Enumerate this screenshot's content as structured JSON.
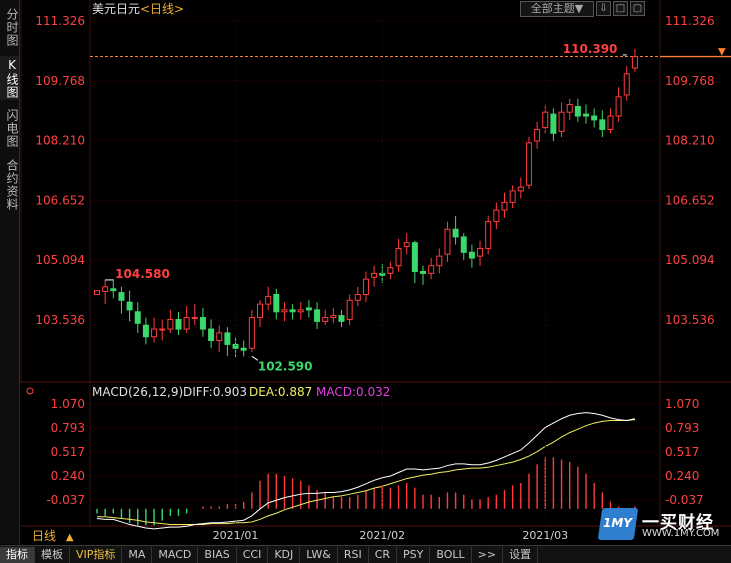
{
  "left_tabs": [
    "分时图",
    "K线图",
    "闪电图",
    "合约资料"
  ],
  "left_tabs_active": 1,
  "header": {
    "symbol": "美元日元",
    "period_tag": "<日线>",
    "theme_button": "全部主题▼",
    "win_buttons": [
      "⇩",
      "□",
      "▢"
    ]
  },
  "bottom": {
    "period_label": "日线",
    "period_arrow": "▲",
    "tabs": [
      "指标",
      "模板",
      "VIP指标",
      "MA",
      "MACD",
      "BIAS",
      "CCI",
      "KDJ",
      "LW&",
      "RSI",
      "CR",
      "PSY",
      "BOLL",
      ">>",
      "设置"
    ],
    "active_tab": 0
  },
  "logo": {
    "badge": "1MY",
    "main": "一买财经",
    "url": "WWW.1MY.COM"
  },
  "colors": {
    "up": "#ff3b3b",
    "down": "#3bd96b",
    "diff": "#ffffff",
    "dea": "#f0f060",
    "macd_label": "#e040e0",
    "axis": "#ff4040",
    "grid": "#3a1010",
    "last_line": "#ff8030"
  },
  "chart_data": [
    {
      "type": "candlestick",
      "title": "美元日元<日线>",
      "ylim": [
        102.3,
        111.9
      ],
      "yticks": [
        111.326,
        109.768,
        108.21,
        106.652,
        105.094,
        103.536
      ],
      "ytick_labels": [
        "111.326",
        "109.768",
        "108.210",
        "106.652",
        "105.094",
        "103.536"
      ],
      "xtick_labels": [
        {
          "label": "2021/01",
          "index": 17
        },
        {
          "label": "2021/02",
          "index": 35
        },
        {
          "label": "2021/03",
          "index": 55
        }
      ],
      "annotations": {
        "high_label": "110.390",
        "high_index": 65,
        "high_value": 110.39,
        "prev_high_label": "104.580",
        "prev_high_index": 1,
        "prev_high_value": 104.58,
        "low_label": "102.590",
        "low_index": 19,
        "low_value": 102.59,
        "last_price": 110.4
      },
      "candles": [
        [
          104.2,
          104.3,
          104.2,
          104.3
        ],
        [
          104.28,
          104.4,
          104.58,
          103.95
        ],
        [
          104.35,
          104.3,
          104.6,
          104.1
        ],
        [
          104.25,
          104.05,
          104.4,
          103.7
        ],
        [
          104.0,
          103.8,
          104.3,
          103.5
        ],
        [
          103.75,
          103.45,
          104.0,
          103.2
        ],
        [
          103.4,
          103.1,
          103.6,
          102.9
        ],
        [
          103.1,
          103.3,
          103.6,
          102.95
        ],
        [
          103.3,
          103.3,
          103.55,
          103.0
        ],
        [
          103.3,
          103.55,
          103.8,
          103.2
        ],
        [
          103.55,
          103.3,
          103.75,
          103.15
        ],
        [
          103.3,
          103.6,
          103.9,
          103.2
        ],
        [
          103.6,
          103.6,
          103.95,
          103.4
        ],
        [
          103.6,
          103.3,
          103.85,
          103.1
        ],
        [
          103.3,
          103.0,
          103.55,
          102.8
        ],
        [
          103.0,
          103.2,
          103.4,
          102.7
        ],
        [
          103.2,
          102.9,
          103.35,
          102.6
        ],
        [
          102.9,
          102.8,
          103.1,
          102.55
        ],
        [
          102.8,
          102.75,
          103.0,
          102.59
        ],
        [
          102.8,
          103.6,
          103.8,
          102.7
        ],
        [
          103.6,
          103.95,
          104.05,
          103.35
        ],
        [
          103.95,
          104.15,
          104.4,
          103.8
        ],
        [
          104.2,
          103.75,
          104.35,
          103.55
        ],
        [
          103.75,
          103.8,
          104.0,
          103.5
        ],
        [
          103.8,
          103.75,
          103.95,
          103.55
        ],
        [
          103.75,
          103.8,
          104.0,
          103.55
        ],
        [
          103.85,
          103.8,
          104.05,
          103.6
        ],
        [
          103.8,
          103.5,
          104.0,
          103.3
        ],
        [
          103.5,
          103.6,
          103.8,
          103.4
        ],
        [
          103.6,
          103.65,
          103.85,
          103.45
        ],
        [
          103.65,
          103.5,
          103.8,
          103.35
        ],
        [
          103.55,
          104.05,
          104.2,
          103.4
        ],
        [
          104.05,
          104.2,
          104.4,
          103.9
        ],
        [
          104.2,
          104.6,
          104.8,
          104.0
        ],
        [
          104.65,
          104.75,
          104.95,
          104.4
        ],
        [
          104.75,
          104.7,
          105.0,
          104.5
        ],
        [
          104.75,
          104.9,
          105.05,
          104.6
        ],
        [
          104.95,
          105.4,
          105.65,
          104.8
        ],
        [
          105.45,
          105.55,
          105.8,
          105.25
        ],
        [
          105.55,
          104.8,
          105.6,
          104.5
        ],
        [
          104.8,
          104.75,
          104.95,
          104.45
        ],
        [
          104.75,
          104.95,
          105.15,
          104.6
        ],
        [
          104.95,
          105.2,
          105.4,
          104.75
        ],
        [
          105.25,
          105.9,
          106.1,
          105.05
        ],
        [
          105.9,
          105.7,
          106.25,
          105.5
        ],
        [
          105.7,
          105.3,
          105.8,
          105.1
        ],
        [
          105.3,
          105.15,
          105.5,
          104.9
        ],
        [
          105.2,
          105.4,
          105.6,
          104.95
        ],
        [
          105.4,
          106.1,
          106.25,
          105.25
        ],
        [
          106.1,
          106.4,
          106.6,
          105.9
        ],
        [
          106.4,
          106.6,
          106.85,
          106.2
        ],
        [
          106.6,
          106.9,
          107.05,
          106.45
        ],
        [
          106.9,
          107.0,
          107.25,
          106.7
        ],
        [
          107.05,
          108.15,
          108.3,
          106.95
        ],
        [
          108.2,
          108.5,
          108.7,
          108.0
        ],
        [
          108.55,
          108.95,
          109.15,
          108.4
        ],
        [
          108.9,
          108.4,
          109.05,
          108.2
        ],
        [
          108.45,
          108.95,
          109.2,
          108.3
        ],
        [
          108.95,
          109.15,
          109.3,
          108.75
        ],
        [
          109.1,
          108.85,
          109.3,
          108.7
        ],
        [
          108.9,
          108.85,
          109.15,
          108.65
        ],
        [
          108.85,
          108.75,
          109.05,
          108.55
        ],
        [
          108.75,
          108.5,
          109.0,
          108.3
        ],
        [
          108.5,
          108.85,
          109.05,
          108.4
        ],
        [
          108.85,
          109.35,
          109.6,
          108.7
        ],
        [
          109.4,
          109.95,
          110.15,
          109.25
        ],
        [
          110.1,
          110.4,
          110.6,
          110.0
        ]
      ]
    },
    {
      "type": "line",
      "title": "MACD(26,12,9)",
      "label_diff": "DIFF:0.903",
      "label_dea": "DEA:0.887",
      "label_macd": "MACD:0.032",
      "ylim": [
        -0.45,
        1.15
      ],
      "yticks": [
        1.07,
        0.793,
        0.517,
        0.24,
        -0.037
      ],
      "ytick_labels": [
        "1.070",
        "0.793",
        "0.517",
        "0.240",
        "-0.037"
      ],
      "series": [
        {
          "name": "DIFF",
          "values": [
            -0.25,
            -0.26,
            -0.26,
            -0.29,
            -0.32,
            -0.34,
            -0.36,
            -0.37,
            -0.36,
            -0.35,
            -0.35,
            -0.34,
            -0.32,
            -0.31,
            -0.3,
            -0.3,
            -0.29,
            -0.28,
            -0.27,
            -0.22,
            -0.14,
            -0.07,
            -0.04,
            -0.01,
            0.01,
            0.03,
            0.04,
            0.04,
            0.05,
            0.05,
            0.06,
            0.08,
            0.11,
            0.15,
            0.19,
            0.22,
            0.24,
            0.28,
            0.32,
            0.32,
            0.31,
            0.32,
            0.33,
            0.36,
            0.38,
            0.38,
            0.37,
            0.37,
            0.39,
            0.42,
            0.46,
            0.5,
            0.54,
            0.62,
            0.71,
            0.8,
            0.85,
            0.9,
            0.94,
            0.96,
            0.97,
            0.96,
            0.94,
            0.91,
            0.89,
            0.88,
            0.9
          ]
        },
        {
          "name": "DEA",
          "values": [
            -0.23,
            -0.23,
            -0.24,
            -0.25,
            -0.26,
            -0.27,
            -0.29,
            -0.3,
            -0.31,
            -0.32,
            -0.32,
            -0.32,
            -0.32,
            -0.32,
            -0.31,
            -0.31,
            -0.31,
            -0.3,
            -0.3,
            -0.29,
            -0.26,
            -0.22,
            -0.19,
            -0.15,
            -0.12,
            -0.09,
            -0.06,
            -0.04,
            -0.02,
            0.0,
            0.01,
            0.03,
            0.05,
            0.07,
            0.1,
            0.12,
            0.15,
            0.18,
            0.21,
            0.23,
            0.25,
            0.26,
            0.28,
            0.29,
            0.31,
            0.32,
            0.33,
            0.33,
            0.34,
            0.36,
            0.38,
            0.4,
            0.43,
            0.47,
            0.52,
            0.58,
            0.63,
            0.69,
            0.74,
            0.78,
            0.82,
            0.85,
            0.87,
            0.88,
            0.88,
            0.88,
            0.89
          ]
        },
        {
          "name": "MACD",
          "values": [
            -0.02,
            -0.03,
            -0.02,
            -0.04,
            -0.06,
            -0.07,
            -0.07,
            -0.07,
            -0.05,
            -0.03,
            -0.03,
            -0.02,
            0.0,
            0.01,
            0.01,
            0.01,
            0.02,
            0.02,
            0.03,
            0.07,
            0.12,
            0.15,
            0.15,
            0.14,
            0.13,
            0.12,
            0.1,
            0.08,
            0.07,
            0.05,
            0.05,
            0.05,
            0.06,
            0.08,
            0.09,
            0.1,
            0.09,
            0.1,
            0.11,
            0.09,
            0.06,
            0.06,
            0.05,
            0.07,
            0.07,
            0.06,
            0.04,
            0.04,
            0.05,
            0.06,
            0.08,
            0.1,
            0.11,
            0.15,
            0.19,
            0.22,
            0.22,
            0.21,
            0.2,
            0.18,
            0.15,
            0.11,
            0.07,
            0.03,
            0.01,
            0.0,
            0.01
          ]
        }
      ]
    }
  ]
}
